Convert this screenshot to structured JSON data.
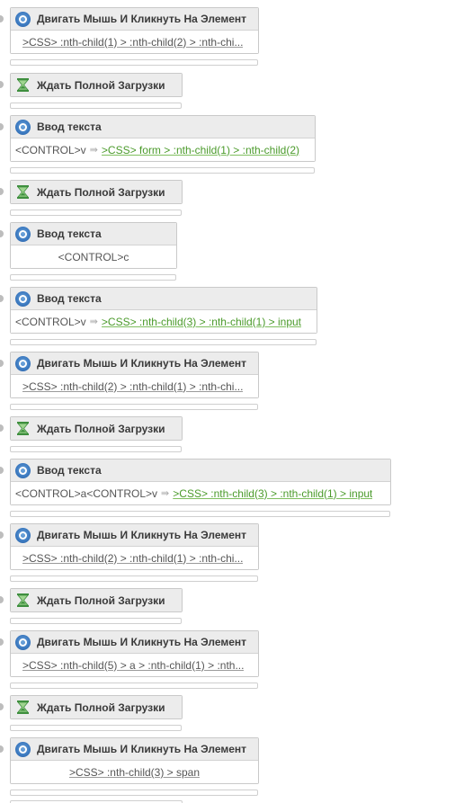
{
  "blocks": [
    {
      "type": "click",
      "title": "Двигать Мышь И Кликнуть На Элемент",
      "selector": ">CSS> :nth-child(1) > :nth-child(2) > :nth-chi..."
    },
    {
      "type": "wait",
      "title": "Ждать Полной Загрузки"
    },
    {
      "type": "input",
      "title": "Ввод текста",
      "text": "<CONTROL>v",
      "selector": ">CSS> form > :nth-child(1) > :nth-child(2)"
    },
    {
      "type": "wait",
      "title": "Ждать Полной Загрузки"
    },
    {
      "type": "input_plain",
      "title": "Ввод текста",
      "text": "<CONTROL>c"
    },
    {
      "type": "input",
      "title": "Ввод текста",
      "text": "<CONTROL>v",
      "selector": ">CSS> :nth-child(3) > :nth-child(1) > input"
    },
    {
      "type": "click",
      "title": "Двигать Мышь И Кликнуть На Элемент",
      "selector": ">CSS> :nth-child(2) > :nth-child(1) > :nth-chi..."
    },
    {
      "type": "wait",
      "title": "Ждать Полной Загрузки"
    },
    {
      "type": "input",
      "title": "Ввод текста",
      "text": "<CONTROL>a<CONTROL>v",
      "selector": ">CSS> :nth-child(3) > :nth-child(1) > input"
    },
    {
      "type": "click",
      "title": "Двигать Мышь И Кликнуть На Элемент",
      "selector": ">CSS> :nth-child(2) > :nth-child(1) > :nth-chi..."
    },
    {
      "type": "wait",
      "title": "Ждать Полной Загрузки"
    },
    {
      "type": "click",
      "title": "Двигать Мышь И Кликнуть На Элемент",
      "selector": ">CSS> :nth-child(5) > a > :nth-child(1) > :nth..."
    },
    {
      "type": "wait",
      "title": "Ждать Полной Загрузки"
    },
    {
      "type": "click_center",
      "title": "Двигать Мышь И Кликнуть На Элемент",
      "selector": ">CSS> :nth-child(3) > span"
    }
  ]
}
